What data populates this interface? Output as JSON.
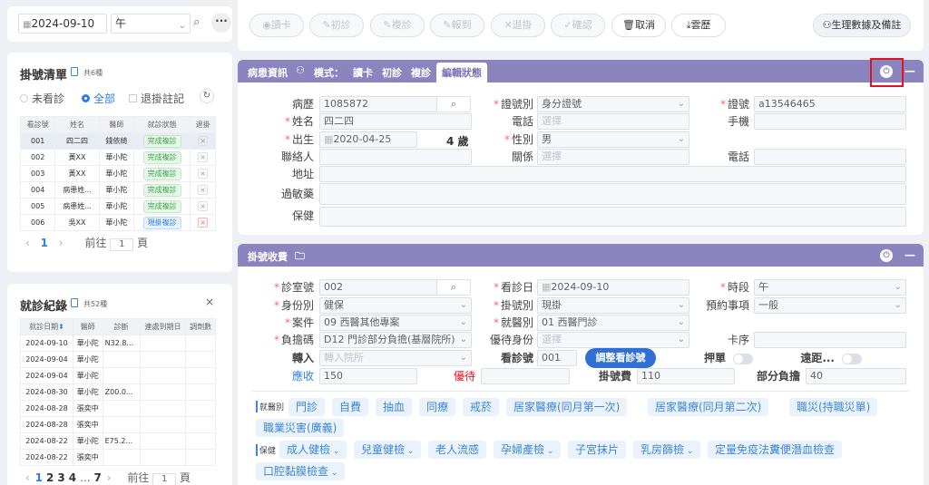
{
  "top": {
    "date": "2024-09-10",
    "session": "午"
  },
  "queue": {
    "title": "掛號清單",
    "count": "共6種",
    "filters": [
      "未看診",
      "全部",
      "退掛註記"
    ],
    "headers": [
      "看診號",
      "姓名",
      "醫師",
      "就診狀態",
      "退掛"
    ],
    "rows": [
      {
        "no": "001",
        "name": "四二四",
        "doc": "錢依綺",
        "status": "完成複診",
        "kind": "g"
      },
      {
        "no": "002",
        "name": "黃XX",
        "doc": "華小陀",
        "status": "完成複診",
        "kind": "g"
      },
      {
        "no": "003",
        "name": "黃XX",
        "doc": "華小陀",
        "status": "完成複診",
        "kind": "g"
      },
      {
        "no": "004",
        "name": "病患姓...",
        "doc": "華小陀",
        "status": "完成複診",
        "kind": "g"
      },
      {
        "no": "005",
        "name": "病患姓...",
        "doc": "華小陀",
        "status": "完成複診",
        "kind": "g"
      },
      {
        "no": "006",
        "name": "吳XX",
        "doc": "華小陀",
        "status": "現掛複診",
        "kind": "b"
      }
    ],
    "page": "1",
    "goto": "前往",
    "goto_val": "1",
    "page_unit": "頁"
  },
  "history": {
    "title": "就診紀錄",
    "count": "共52種",
    "headers": [
      "就診日期",
      "醫師",
      "診斷",
      "連處到期日",
      "調劑數"
    ],
    "rows": [
      {
        "date": "2024-09-10",
        "doc": "華小陀",
        "dx": "N32.8..."
      },
      {
        "date": "2024-09-04",
        "doc": "華小陀",
        "dx": ""
      },
      {
        "date": "2024-09-04",
        "doc": "華小陀",
        "dx": ""
      },
      {
        "date": "2024-08-30",
        "doc": "華小陀",
        "dx": "Z00.0..."
      },
      {
        "date": "2024-08-28",
        "doc": "張奕中",
        "dx": ""
      },
      {
        "date": "2024-08-28",
        "doc": "張奕中",
        "dx": ""
      },
      {
        "date": "2024-08-22",
        "doc": "華小陀",
        "dx": "E75.2..."
      },
      {
        "date": "2024-08-22",
        "doc": "張奕中",
        "dx": ""
      }
    ],
    "pages": [
      "1",
      "2",
      "3",
      "4",
      "...",
      "7"
    ],
    "goto": "前往",
    "goto_val": "1",
    "page_unit": "頁"
  },
  "toolbar": {
    "buttons": [
      "讀卡",
      "初診",
      "複診",
      "報到",
      "退掛",
      "確認",
      "取消",
      "雲歷"
    ],
    "right": "生理數據及備註"
  },
  "patient": {
    "tabs": [
      "病患資訊",
      "模式：",
      "讀卡",
      "初診",
      "複診",
      "編輯狀態"
    ],
    "record_label": "病歷",
    "record": "1085872",
    "idtype_label": "證號別",
    "idtype": "身分證號",
    "idno_label": "證號",
    "idno": "a13546465",
    "name_label": "姓名",
    "name": "四二四",
    "phone_label": "電話",
    "phone_ph": "選擇",
    "mobile_label": "手機",
    "birth_label": "出生",
    "birth": "2020-04-25",
    "age": "4 歲",
    "sex_label": "性別",
    "sex": "男",
    "contact_label": "聯絡人",
    "relation_label": "關係",
    "relation_ph": "選擇",
    "phone2_label": "電話",
    "addr_label": "地址",
    "allergy_label": "過敏藥",
    "ins_label": "保健"
  },
  "reg": {
    "title": "掛號收費",
    "room_label": "診室號",
    "room": "002",
    "date_label": "看診日",
    "date": "2024-09-10",
    "slot_label": "時段",
    "slot": "午",
    "identity_label": "身份別",
    "identity": "健保",
    "regtype_label": "掛號別",
    "regtype": "現掛",
    "appt_label": "預約事項",
    "appt": "一般",
    "case_label": "案件",
    "case": "09 西醫其他專案",
    "visit_label": "就醫別",
    "visit": "01 西醫門診",
    "copay_label": "負擔碼",
    "copay": "D12 門診部分負擔(基層院所)",
    "priority_label": "優待身份",
    "priority_ph": "選擇",
    "card_label": "卡序",
    "transfer_label": "轉入",
    "transfer_ph": "轉入院所",
    "no_label": "看診號",
    "no": "001",
    "adjust": "調整看診號",
    "deposit_label": "押單",
    "remote_label": "遠距...",
    "due_label": "應收",
    "due": "150",
    "disc_label": "優待",
    "fee_label": "掛號費",
    "fee": "110",
    "part_label": "部分負擔",
    "part": "40"
  },
  "chips": {
    "group1": "就醫別",
    "row1": [
      "門診",
      "自費",
      "抽血",
      "同療",
      "戒菸",
      "居家醫療(同月第一次)",
      "居家醫療(同月第二次)",
      "職災(持職災單)"
    ],
    "row2": [
      "職業災害(廣義)"
    ],
    "group2": "保健",
    "row3": [
      "成人健檢",
      "兒童健檢",
      "老人流感",
      "孕婦產檢",
      "子宮抹片",
      "乳房篩檢",
      "定量免疫法糞便潛血檢查"
    ],
    "row4": [
      "口腔黏膜檢查"
    ]
  },
  "colors": {
    "accent": "#8a84bf",
    "link": "#2f7fe0",
    "highlight": "#e0141e"
  }
}
